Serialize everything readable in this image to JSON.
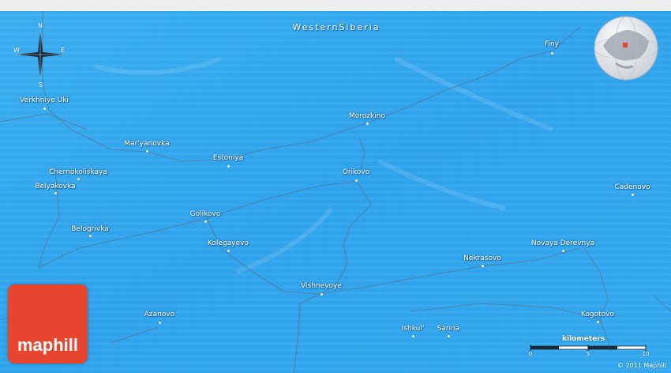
{
  "region_title": "WesternSiberia",
  "compass": {
    "n": "N",
    "s": "S",
    "e": "E",
    "w": "W"
  },
  "colors": {
    "water_blue": "#31a7ee",
    "road": "#4f7fa6",
    "logo_red": "#e8452e",
    "label_text": "#ffffff"
  },
  "places": [
    {
      "name": "Verkhniye Uki"
    },
    {
      "name": "Mar'yanovka"
    },
    {
      "name": "Estoniya"
    },
    {
      "name": "Morozkino"
    },
    {
      "name": "Finy"
    },
    {
      "name": "Chernokoliskaya"
    },
    {
      "name": "Belyakovka"
    },
    {
      "name": "Orikovo"
    },
    {
      "name": "Cadenovo"
    },
    {
      "name": "Golikovo"
    },
    {
      "name": "Belogrivka"
    },
    {
      "name": "Kolegayevo"
    },
    {
      "name": "Novaya Derevnya"
    },
    {
      "name": "Nekrasovo"
    },
    {
      "name": "Vishnevoye"
    },
    {
      "name": "Azanovo"
    },
    {
      "name": "Kogotovo"
    },
    {
      "name": "Ishkul'"
    },
    {
      "name": "Sarina"
    }
  ],
  "logo": {
    "text": "maphill"
  },
  "scale": {
    "title": "kilometers",
    "ticks": [
      "0",
      "5",
      "10"
    ]
  },
  "copyright": "© 2011 Maphill"
}
